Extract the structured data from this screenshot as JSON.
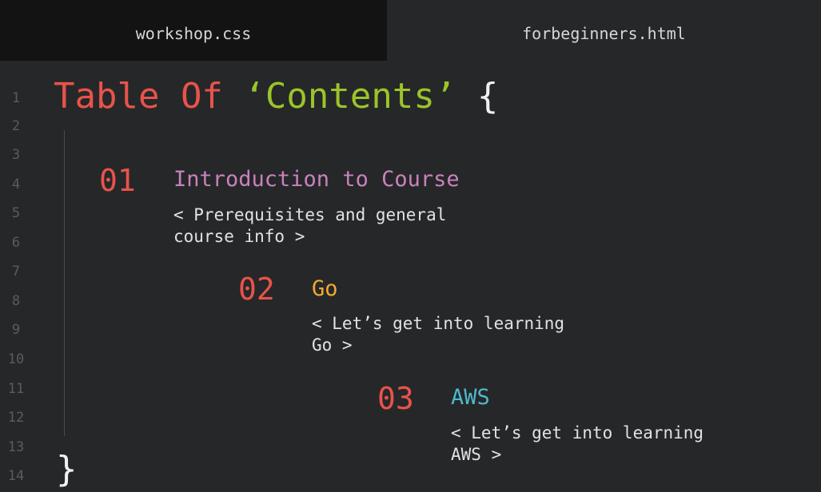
{
  "tabs": [
    {
      "label": "workshop.css",
      "active": false
    },
    {
      "label": "forbeginners.html",
      "active": true
    }
  ],
  "line_numbers": [
    "1",
    "2",
    "3",
    "4",
    "5",
    "6",
    "7",
    "8",
    "9",
    "10",
    "11",
    "12",
    "13",
    "14"
  ],
  "code": {
    "title_part1": "Table Of ",
    "title_part2": "‘Contents’",
    "open_brace": " {",
    "close_brace": "}"
  },
  "items": [
    {
      "number": "01",
      "title": "Introduction to Course",
      "title_color": "#c882bd",
      "desc_line1": "< Prerequisites and general",
      "desc_line2": "course info >"
    },
    {
      "number": "02",
      "title": "Go",
      "title_color": "#f0a92f",
      "desc_line1": "< Let’s get into learning",
      "desc_line2": "Go >"
    },
    {
      "number": "03",
      "title": "AWS",
      "title_color": "#4fb8cf",
      "desc_line1": "< Let’s get into learning",
      "desc_line2": "AWS >"
    }
  ],
  "colors": {
    "keyword_red": "#e8534c",
    "string_green": "#9bc42a",
    "background": "#262728",
    "inactive_tab": "#131313"
  }
}
